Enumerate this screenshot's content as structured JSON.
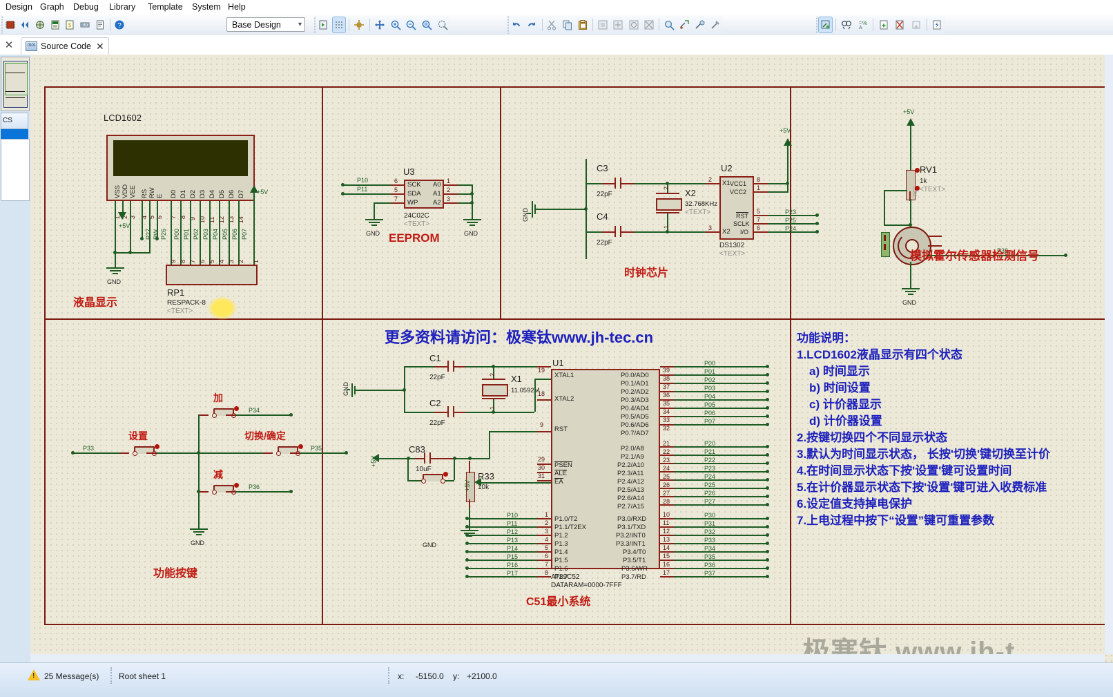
{
  "window": {
    "menu": [
      "Design",
      "Graph",
      "Debug",
      "Library",
      "Template",
      "System",
      "Help"
    ],
    "design_combo": "Base Design",
    "tab_label": "Source Code",
    "tab_icon": "binary-file-icon"
  },
  "statusbar": {
    "messages": "25 Message(s)",
    "sheet": "Root sheet 1",
    "coord_x_label": "x:",
    "coord_x": "-5150.0",
    "coord_y_label": "y:",
    "coord_y": "+2100.0"
  },
  "schematic": {
    "banner": "更多资料请访问：极寒钛www.jh-tec.cn",
    "watermark": "极寒钛 www.jh-t",
    "sections": {
      "lcd": {
        "caption": "液晶显示",
        "ref": "LCD1602",
        "pin_names": [
          "VSS",
          "VDD",
          "VEE",
          "RS",
          "RW",
          "E",
          "D0",
          "D1",
          "D2",
          "D3",
          "D4",
          "D5",
          "D6",
          "D7"
        ],
        "pin_numbers": [
          "1",
          "2",
          "3",
          "4",
          "5",
          "6",
          "7",
          "8",
          "9",
          "10",
          "11",
          "12",
          "13",
          "14"
        ],
        "nets": [
          "P27",
          "RW",
          "P26",
          "P00",
          "P01",
          "P02",
          "P03",
          "P04",
          "P05",
          "P06",
          "P07"
        ],
        "rp_ref": "RP1",
        "rp_value": "RESPACK-8",
        "rp_text": "<TEXT>",
        "rp_pin_numbers": [
          "9",
          "8",
          "7",
          "6",
          "5",
          "4",
          "3",
          "2",
          "1"
        ],
        "power": "+5V",
        "gnd": "GND"
      },
      "eeprom": {
        "caption": "EEPROM",
        "ref": "U3",
        "value": "24C02C",
        "text": "<TEXT>",
        "left_pins": [
          {
            "name": "SCK",
            "num": "6",
            "net": "P10"
          },
          {
            "name": "SDA",
            "num": "5",
            "net": "P11"
          },
          {
            "name": "WP",
            "num": "7",
            "net": ""
          }
        ],
        "right_pins": [
          {
            "name": "A0",
            "num": "1"
          },
          {
            "name": "A1",
            "num": "2"
          },
          {
            "name": "A2",
            "num": "3"
          }
        ],
        "gnd": "GND"
      },
      "rtc": {
        "caption": "时钟芯片",
        "ref": "U2",
        "value": "DS1302",
        "text": "<TEXT>",
        "xtal_ref": "X2",
        "xtal_value": "32.768KHz",
        "xtal_text": "<TEXT>",
        "c3_ref": "C3",
        "c3_value": "22pF",
        "c4_ref": "C4",
        "c4_value": "22pF",
        "left_pins": [
          {
            "name": "X1",
            "num": "2"
          },
          {
            "name": "X2",
            "num": "3"
          }
        ],
        "right_pins": [
          {
            "name": "VCC1",
            "num": "8",
            "net": ""
          },
          {
            "name": "VCC2",
            "num": "1",
            "net": ""
          },
          {
            "name": "RST",
            "num": "5",
            "net": "P23"
          },
          {
            "name": "SCLK",
            "num": "7",
            "net": "P25"
          },
          {
            "name": "I/O",
            "num": "6",
            "net": "P24"
          }
        ],
        "power": "+5V",
        "gnd": "GND"
      },
      "hall": {
        "caption": "模拟霍尔传感器检测信号",
        "pot_ref": "RV1",
        "pot_value": "1k",
        "pot_text": "<TEXT>",
        "net": "P32",
        "power": "+5V",
        "gnd": "GND"
      },
      "keys": {
        "caption": "功能按键",
        "buttons": [
          {
            "label": "加",
            "net": "P34"
          },
          {
            "label": "设置",
            "net": "P33"
          },
          {
            "label": "切换/确定",
            "net": "P35"
          },
          {
            "label": "减",
            "net": "P36"
          }
        ],
        "gnd": "GND"
      },
      "mcu": {
        "caption": "C51最小系统",
        "ref": "U1",
        "value": "AT89C52",
        "dataram": "DATARAM=0000-7FFF",
        "xtal_ref": "X1",
        "xtal_value": "11.0592M",
        "c1_ref": "C1",
        "c1_value": "22pF",
        "c2_ref": "C2",
        "c2_value": "22pF",
        "c83_ref": "C83",
        "c83_value": "10uF",
        "r33_ref": "R33",
        "r33_value": "10k",
        "power": "+5V",
        "gnd": "GND",
        "left_ctrl": [
          {
            "name": "XTAL1",
            "num": "19"
          },
          {
            "name": "XTAL2",
            "num": "18"
          },
          {
            "name": "RST",
            "num": "9"
          },
          {
            "name": "PSEN",
            "num": "29"
          },
          {
            "name": "ALE",
            "num": "30"
          },
          {
            "name": "EA",
            "num": "31"
          }
        ],
        "p1_pins": [
          {
            "name": "P1.0/T2",
            "num": "1",
            "net": "P10"
          },
          {
            "name": "P1.1/T2EX",
            "num": "2",
            "net": "P11"
          },
          {
            "name": "P1.2",
            "num": "3",
            "net": "P12"
          },
          {
            "name": "P1.3",
            "num": "4",
            "net": "P13"
          },
          {
            "name": "P1.4",
            "num": "5",
            "net": "P14"
          },
          {
            "name": "P1.5",
            "num": "6",
            "net": "P15"
          },
          {
            "name": "P1.6",
            "num": "7",
            "net": "P16"
          },
          {
            "name": "P1.7",
            "num": "8",
            "net": "P17"
          }
        ],
        "p0_pins": [
          {
            "name": "P0.0/AD0",
            "num": "39",
            "net": "P00"
          },
          {
            "name": "P0.1/AD1",
            "num": "38",
            "net": "P01"
          },
          {
            "name": "P0.2/AD2",
            "num": "37",
            "net": "P02"
          },
          {
            "name": "P0.3/AD3",
            "num": "36",
            "net": "P03"
          },
          {
            "name": "P0.4/AD4",
            "num": "35",
            "net": "P04"
          },
          {
            "name": "P0.5/AD5",
            "num": "34",
            "net": "P05"
          },
          {
            "name": "P0.6/AD6",
            "num": "33",
            "net": "P06"
          },
          {
            "name": "P0.7/AD7",
            "num": "32",
            "net": "P07"
          }
        ],
        "p2_pins": [
          {
            "name": "P2.0/A8",
            "num": "21",
            "net": "P20"
          },
          {
            "name": "P2.1/A9",
            "num": "22",
            "net": "P21"
          },
          {
            "name": "P2.2/A10",
            "num": "23",
            "net": "P22"
          },
          {
            "name": "P2.3/A11",
            "num": "24",
            "net": "P23"
          },
          {
            "name": "P2.4/A12",
            "num": "25",
            "net": "P24"
          },
          {
            "name": "P2.5/A13",
            "num": "26",
            "net": "P25"
          },
          {
            "name": "P2.6/A14",
            "num": "27",
            "net": "P26"
          },
          {
            "name": "P2.7/A15",
            "num": "28",
            "net": "P27"
          }
        ],
        "p3_pins": [
          {
            "name": "P3.0/RXD",
            "num": "10",
            "net": "P30"
          },
          {
            "name": "P3.1/TXD",
            "num": "11",
            "net": "P31"
          },
          {
            "name": "P3.2/INT0",
            "num": "12",
            "net": "P32"
          },
          {
            "name": "P3.3/INT1",
            "num": "13",
            "net": "P33"
          },
          {
            "name": "P3.4/T0",
            "num": "14",
            "net": "P34"
          },
          {
            "name": "P3.5/T1",
            "num": "15",
            "net": "P35"
          },
          {
            "name": "P3.6/WR",
            "num": "16",
            "net": "P36"
          },
          {
            "name": "P3.7/RD",
            "num": "17",
            "net": "P37"
          }
        ]
      },
      "notes": {
        "title": "功能说明：",
        "lines": [
          "1.LCD1602液晶显示有四个状态",
          "a) 时间显示",
          "b) 时间设置",
          "c) 计价器显示",
          "d) 计价器设置",
          "2.按键切换四个不同显示状态",
          "3.默认为时间显示状态， 长按'切换'键切换至计价",
          "4.在时间显示状态下按'设置'键可设置时间",
          "5.在计价器显示状态下按'设置'键可进入收费标准",
          "6.设定值支持掉电保护",
          "7.上电过程中按下“设置”键可重置参数"
        ]
      }
    }
  },
  "colors": {
    "wire": "#1e5c24",
    "pin": "#8a2018",
    "sheet_border": "#7b1a10",
    "caption_red": "#c01a12",
    "note_blue": "#1d20bd",
    "canvas": "#ece9d8"
  }
}
